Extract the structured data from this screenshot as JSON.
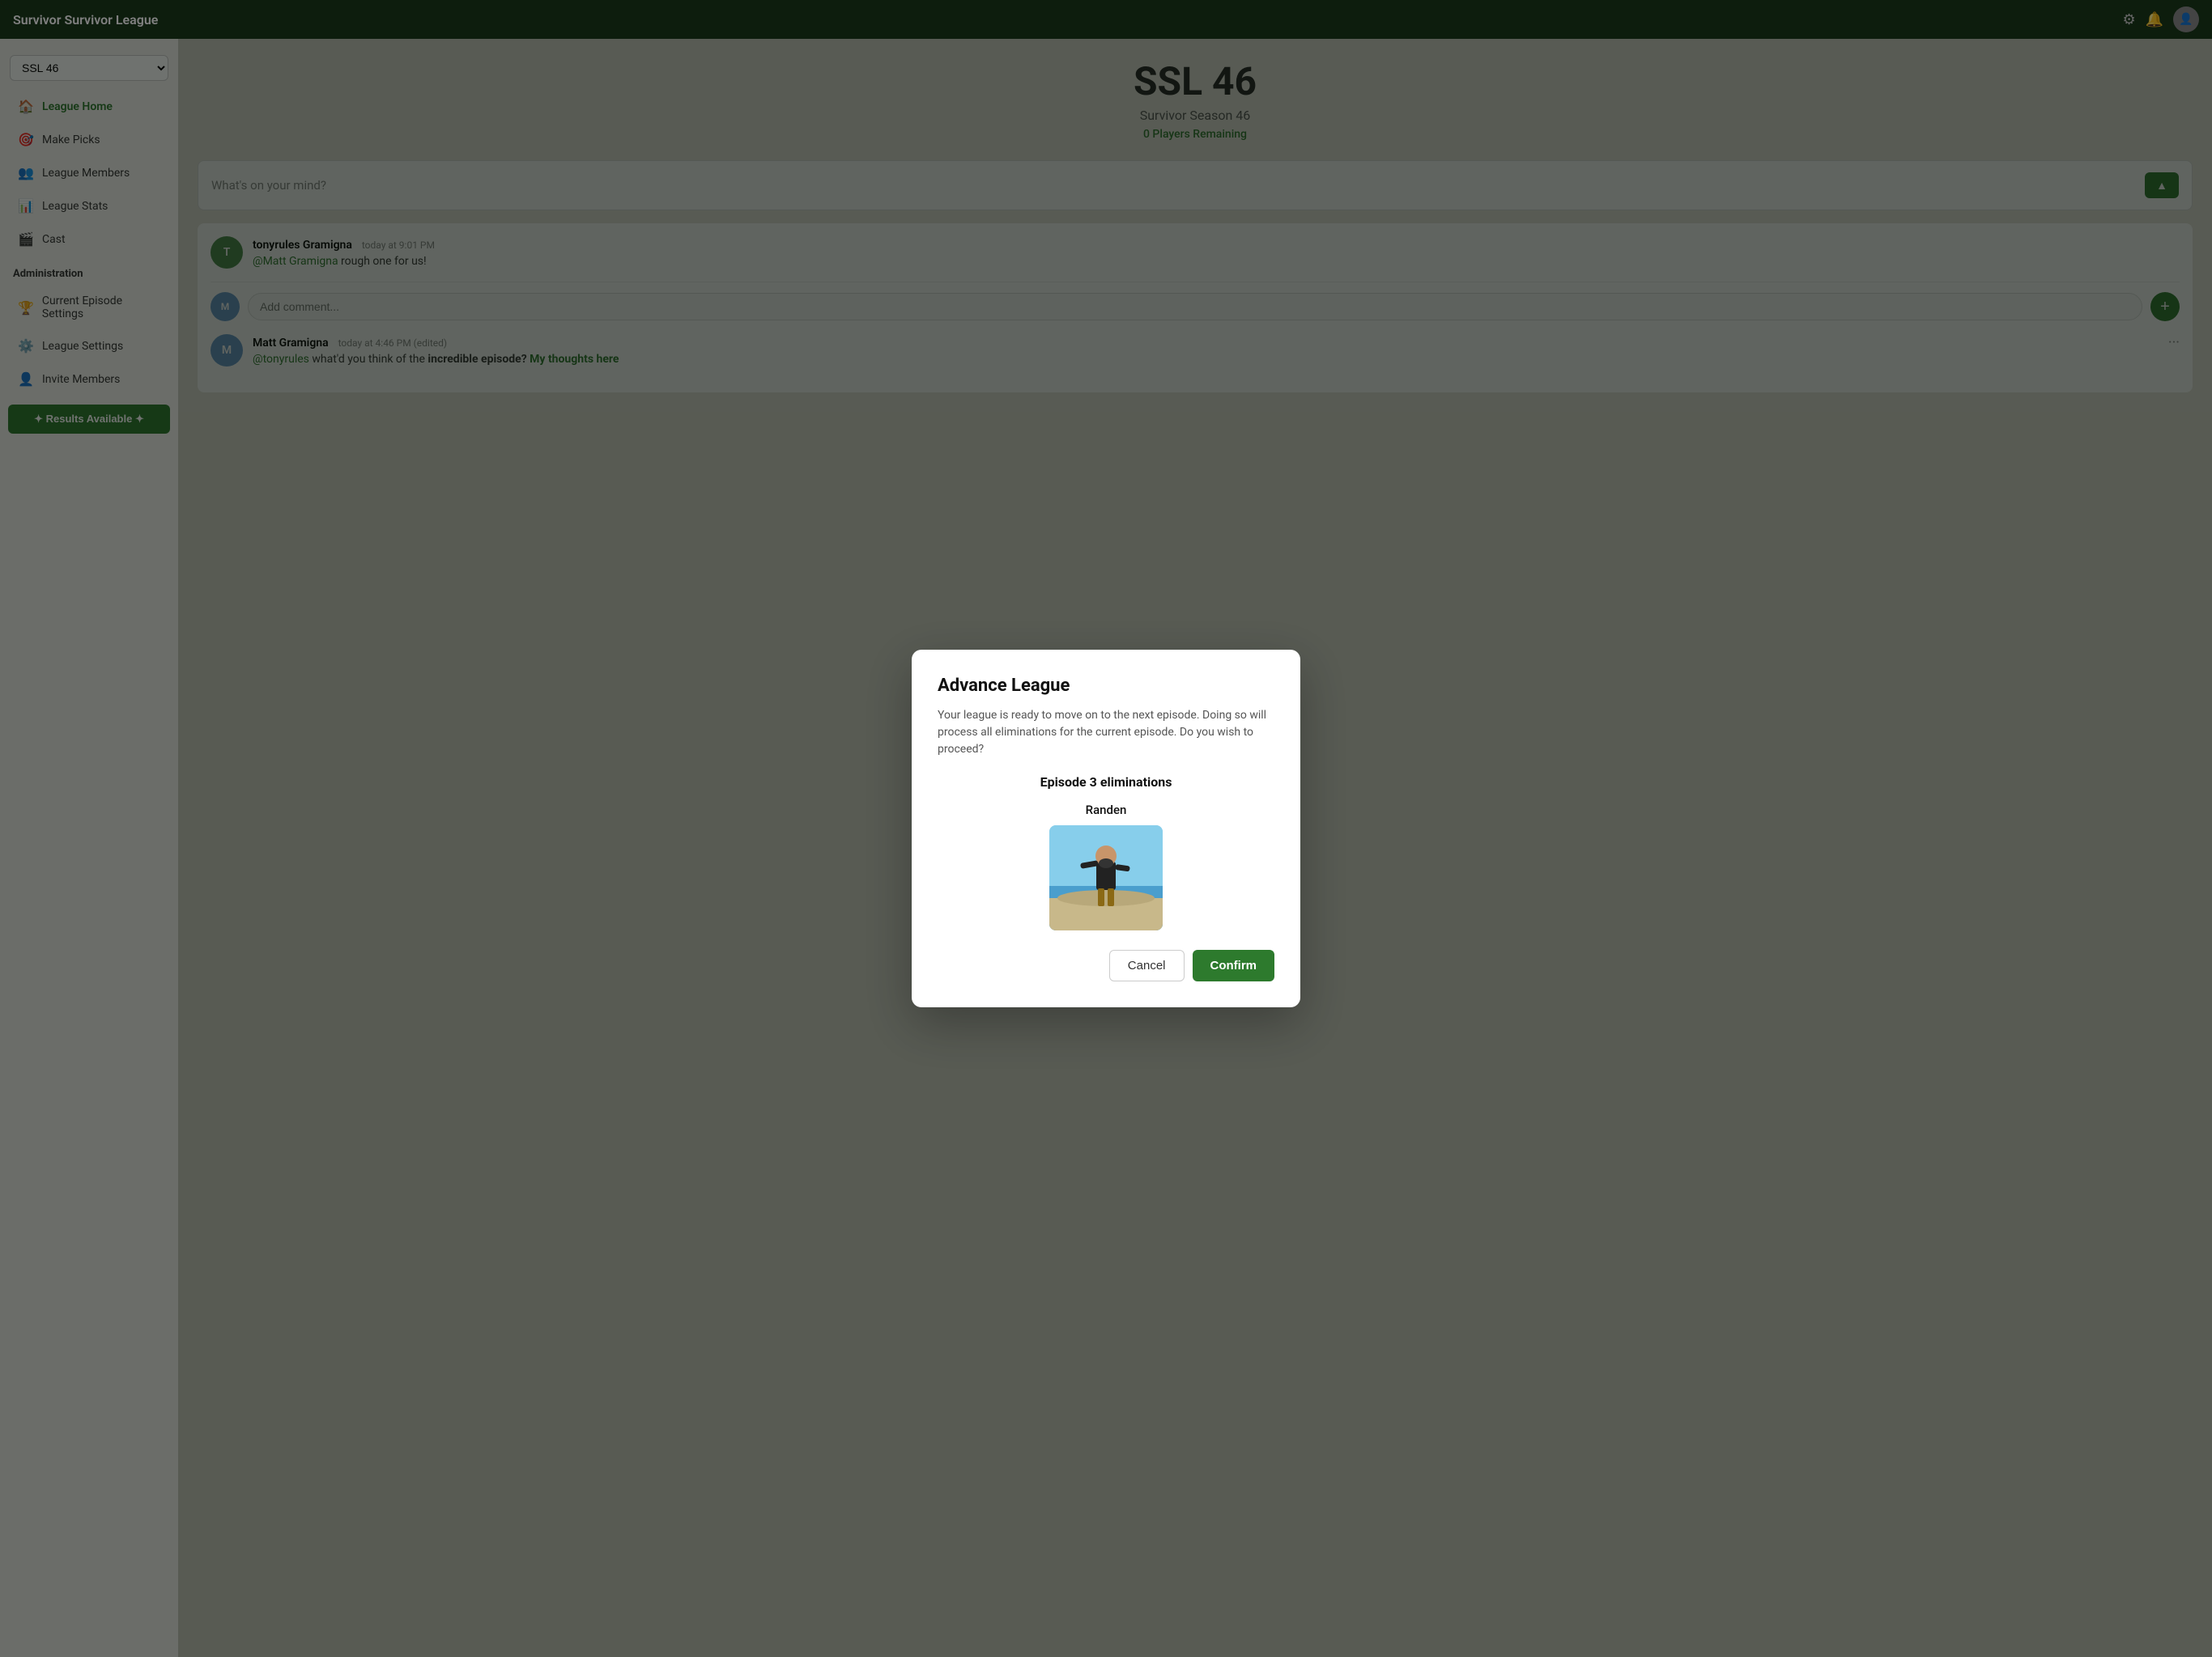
{
  "app": {
    "title": "Survivor Survivor League"
  },
  "sidebar": {
    "select_value": "SSL 46",
    "nav_items": [
      {
        "label": "League Home",
        "icon": "🏠",
        "active": true
      },
      {
        "label": "Make Picks",
        "icon": "🎯",
        "active": false
      },
      {
        "label": "League Members",
        "icon": "👥",
        "active": false
      },
      {
        "label": "League Stats",
        "icon": "📊",
        "active": false
      },
      {
        "label": "Cast",
        "icon": "🎬",
        "active": false
      }
    ],
    "admin_section": "Administration",
    "admin_items": [
      {
        "label": "Current Episode Settings",
        "icon": "🏆"
      },
      {
        "label": "League Settings",
        "icon": "⚙️"
      },
      {
        "label": "Invite Members",
        "icon": "👤"
      }
    ],
    "results_btn": "✦ Results Available ✦"
  },
  "league": {
    "title": "SSL 46",
    "subtitle": "Survivor Season 46",
    "players_remaining": "0 Players Remaining"
  },
  "comment_box": {
    "placeholder": "What's on your mind?"
  },
  "comments": [
    {
      "author": "tonyrules Gramigna",
      "time": "today at 9:01 PM",
      "text": "@Matt Gramigna rough one for us!",
      "avatar_initials": "T",
      "avatar_color": "#4a8a4a"
    },
    {
      "author": "Matt Gramigna",
      "time": "today at 4:46 PM (edited)",
      "text_parts": [
        {
          "type": "link",
          "text": "@tonyrules"
        },
        {
          "type": "normal",
          "text": " what'd you think of the "
        },
        {
          "type": "bold",
          "text": "incredible episode?"
        },
        {
          "type": "link",
          "text": " My thoughts here"
        }
      ],
      "avatar_initials": "M",
      "avatar_color": "#6699cc"
    }
  ],
  "add_comment_placeholder": "Add comment...",
  "modal": {
    "title": "Advance League",
    "description": "Your league is ready to move on to the next episode. Doing so will process all eliminations for the current episode. Do you wish to proceed?",
    "episode_title": "Episode 3 eliminations",
    "player_name": "Randen",
    "cancel_label": "Cancel",
    "confirm_label": "Confirm"
  }
}
